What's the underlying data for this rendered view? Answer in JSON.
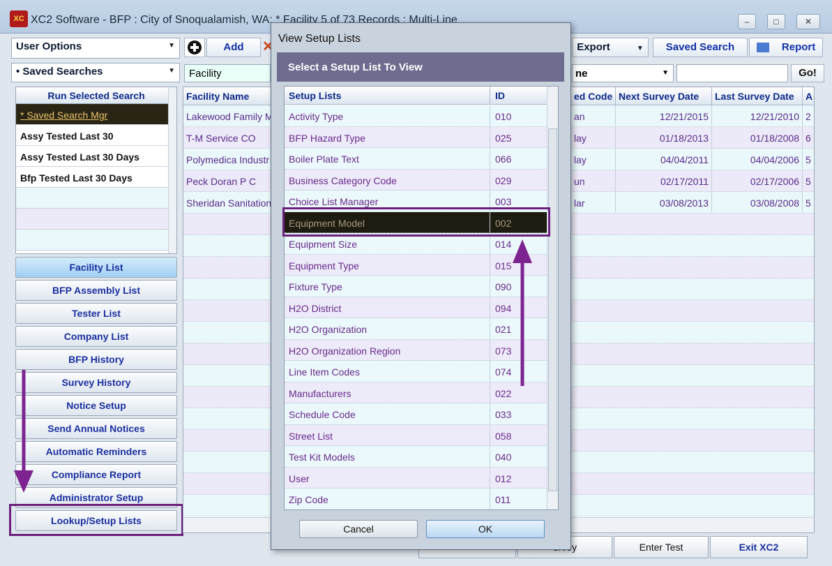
{
  "window": {
    "title": "XC2 Software - BFP : City of Snoqualamish, WA: * Facility 5 of 73 Records : Multi-Line",
    "icon": "XC",
    "controls": [
      "–",
      "□",
      "✕"
    ]
  },
  "toolbar": {
    "user_options": "User Options",
    "add_label": "Add",
    "export_label": "Export",
    "saved_search_label": "Saved Search",
    "report_label": "Report",
    "saved_searches": "• Saved Searches",
    "search_field": "Facility",
    "search_op": "ne",
    "go_label": "Go!"
  },
  "sidebar": {
    "list_header": "Run Selected Search",
    "searches": [
      "* Saved Search Mgr",
      "Assy Tested Last 30",
      "Assy Tested Last 30 Days",
      "Bfp Tested Last 30 Days"
    ],
    "nav": [
      "Facility List",
      "BFP Assembly List",
      "Tester List",
      "Company List",
      "BFP History",
      "Survey History",
      "Notice Setup",
      "Send Annual Notices",
      "Automatic Reminders",
      "Compliance Report",
      "Administrator Setup",
      "Lookup/Setup Lists"
    ]
  },
  "grid": {
    "headers": {
      "facility_name": "Facility Name",
      "code": "ed Code",
      "next": "Next Survey Date",
      "last": "Last Survey Date",
      "a": "A"
    },
    "rows": [
      {
        "name": "Lakewood Family M",
        "code": "an",
        "next": "12/21/2015",
        "last": "12/21/2010",
        "a": "2"
      },
      {
        "name": "T-M Service CO",
        "code": "lay",
        "next": "01/18/2013",
        "last": "01/18/2008",
        "a": "6"
      },
      {
        "name": "Polymedica Industr",
        "code": "lay",
        "next": "04/04/2011",
        "last": "04/04/2006",
        "a": "5"
      },
      {
        "name": "Peck Doran P C",
        "code": "un",
        "next": "02/17/2011",
        "last": "02/17/2006",
        "a": "5"
      },
      {
        "name": "Sheridan Sanitation",
        "code": "lar",
        "next": "03/08/2013",
        "last": "03/08/2008",
        "a": "5"
      }
    ]
  },
  "bottom": {
    "survey": "urvey",
    "enter_test": "Enter Test",
    "exit": "Exit XC2"
  },
  "dialog": {
    "title": "View Setup Lists",
    "header": "Select a Setup List To View",
    "col_name": "Setup Lists",
    "col_id": "ID",
    "items": [
      {
        "name": "Activity Type",
        "id": "010"
      },
      {
        "name": "BFP Hazard Type",
        "id": "025"
      },
      {
        "name": "Boiler Plate Text",
        "id": "066"
      },
      {
        "name": "Business Category Code",
        "id": "029"
      },
      {
        "name": "Choice List Manager",
        "id": "003"
      },
      {
        "name": "Equipment Model",
        "id": "002"
      },
      {
        "name": "Equipment Size",
        "id": "014"
      },
      {
        "name": "Equipment Type",
        "id": "015"
      },
      {
        "name": "Fixture Type",
        "id": "090"
      },
      {
        "name": "H2O District",
        "id": "094"
      },
      {
        "name": "H2O Organization",
        "id": "021"
      },
      {
        "name": "H2O Organization Region",
        "id": "073"
      },
      {
        "name": "Line Item Codes",
        "id": "074"
      },
      {
        "name": "Manufacturers",
        "id": "022"
      },
      {
        "name": "Schedule Code",
        "id": "033"
      },
      {
        "name": "Street List",
        "id": "058"
      },
      {
        "name": "Test Kit Models",
        "id": "040"
      },
      {
        "name": "User",
        "id": "012"
      },
      {
        "name": "Zip Code",
        "id": "011"
      }
    ],
    "selected_index": 5,
    "cancel_label": "Cancel",
    "ok_label": "OK"
  },
  "colors": {
    "highlight": "#6b1f7d",
    "arrow": "#7d2490",
    "row_text": "#6a2a8a"
  }
}
